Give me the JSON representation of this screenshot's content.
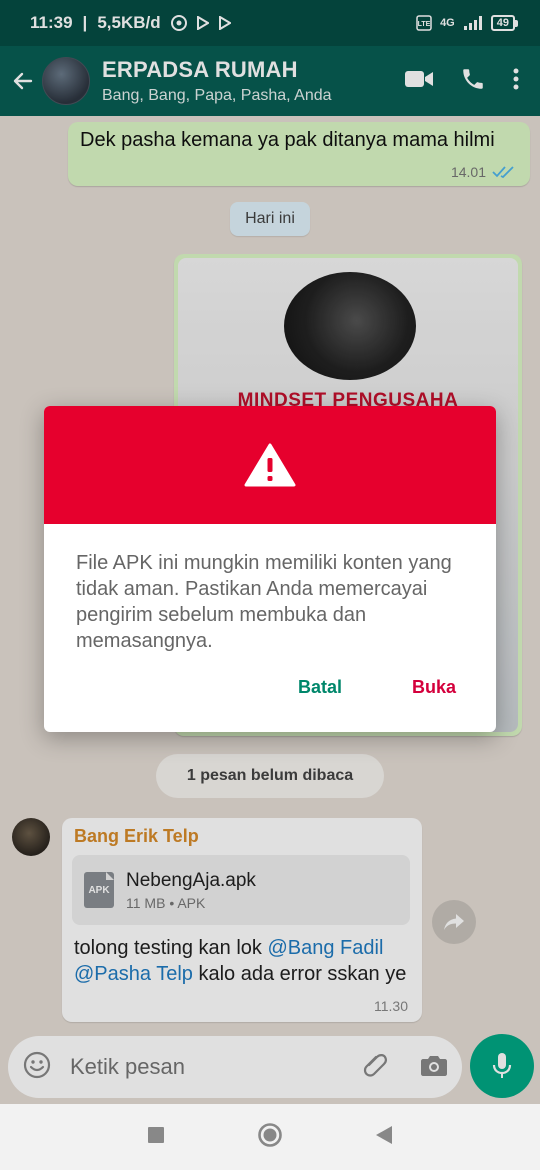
{
  "status_bar": {
    "time": "11:39",
    "net_speed": "5,5KB/d",
    "network": "4G",
    "battery": "49"
  },
  "header": {
    "title": "ERPADSA RUMAH",
    "members": "Bang, Bang, Papa, Pasha, Anda"
  },
  "messages": {
    "outgoing_text": "Dek pasha kemana ya pak ditanya mama hilmi",
    "outgoing_time": "14.01",
    "date_chip": "Hari ini",
    "image_headline": "MINDSET PENGUSAHA",
    "unread_chip": "1 pesan belum dibaca",
    "incoming": {
      "sender": "Bang Erik Telp",
      "file_name": "NebengAja.apk",
      "file_meta": "11 MB • APK",
      "file_icon_label": "APK",
      "text_1": "tolong testing kan lok ",
      "mention_1": "@Bang Fadil",
      "text_2": " ",
      "mention_2": "@Pasha Telp",
      "text_3": " kalo ada error sskan ye",
      "time": "11.30"
    }
  },
  "composer": {
    "placeholder": "Ketik pesan"
  },
  "dialog": {
    "message": "File APK ini mungkin memiliki konten yang tidak aman. Pastikan Anda memercayai pengirim sebelum membuka dan memasangnya.",
    "cancel_label": "Batal",
    "open_label": "Buka"
  },
  "colors": {
    "appbar": "#075e54",
    "dialog_header": "#e6002d",
    "cancel": "#00876b",
    "open": "#d4003c",
    "mic": "#00a884"
  }
}
